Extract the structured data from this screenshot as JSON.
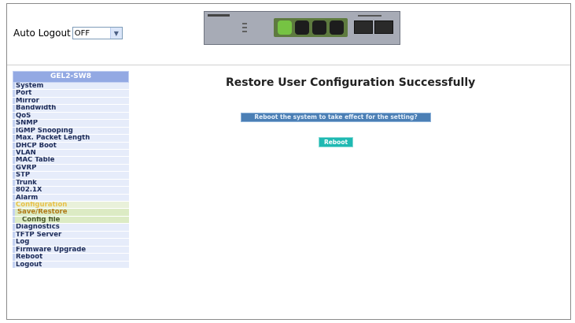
{
  "auto_logout": {
    "label": "Auto Logout",
    "selected": "OFF"
  },
  "sidebar": {
    "title": "GEL2-SW8",
    "items": [
      {
        "label": "System"
      },
      {
        "label": "Port"
      },
      {
        "label": "Mirror"
      },
      {
        "label": "Bandwidth"
      },
      {
        "label": "QoS"
      },
      {
        "label": "SNMP"
      },
      {
        "label": "IGMP Snooping"
      },
      {
        "label": "Max. Packet Length"
      },
      {
        "label": "DHCP Boot"
      },
      {
        "label": "VLAN"
      },
      {
        "label": "MAC Table"
      },
      {
        "label": "GVRP"
      },
      {
        "label": "STP"
      },
      {
        "label": "Trunk"
      },
      {
        "label": "802.1X"
      },
      {
        "label": "Alarm"
      },
      {
        "label": "Configuration"
      },
      {
        "label": "Save/Restore"
      },
      {
        "label": "Config file"
      },
      {
        "label": "Diagnostics"
      },
      {
        "label": "TFTP Server"
      },
      {
        "label": "Log"
      },
      {
        "label": "Firmware Upgrade"
      },
      {
        "label": "Reboot"
      },
      {
        "label": "Logout"
      }
    ]
  },
  "main": {
    "title": "Restore User Configuration Successfully",
    "info": "Reboot the system to take effect for the setting?",
    "reboot_button": "Reboot"
  }
}
